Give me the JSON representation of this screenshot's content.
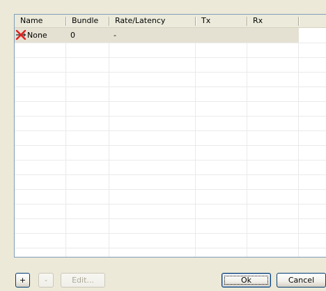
{
  "table": {
    "columns": [
      "Name",
      "Bundle",
      "Rate/Latency",
      "Tx",
      "Rx"
    ],
    "rows": [
      {
        "name": "None",
        "bundle": "0",
        "rate_latency": "-",
        "tx": "",
        "rx": "",
        "icon": "red-x-cross-icon",
        "selected": true
      }
    ]
  },
  "buttons": {
    "add": "+",
    "remove": "-",
    "edit": "Edit...",
    "ok": "Ok",
    "cancel": "Cancel"
  },
  "colors": {
    "selected_row": "#e4e1d3",
    "button_border": "#003c74",
    "icon_red": "#e02020"
  }
}
